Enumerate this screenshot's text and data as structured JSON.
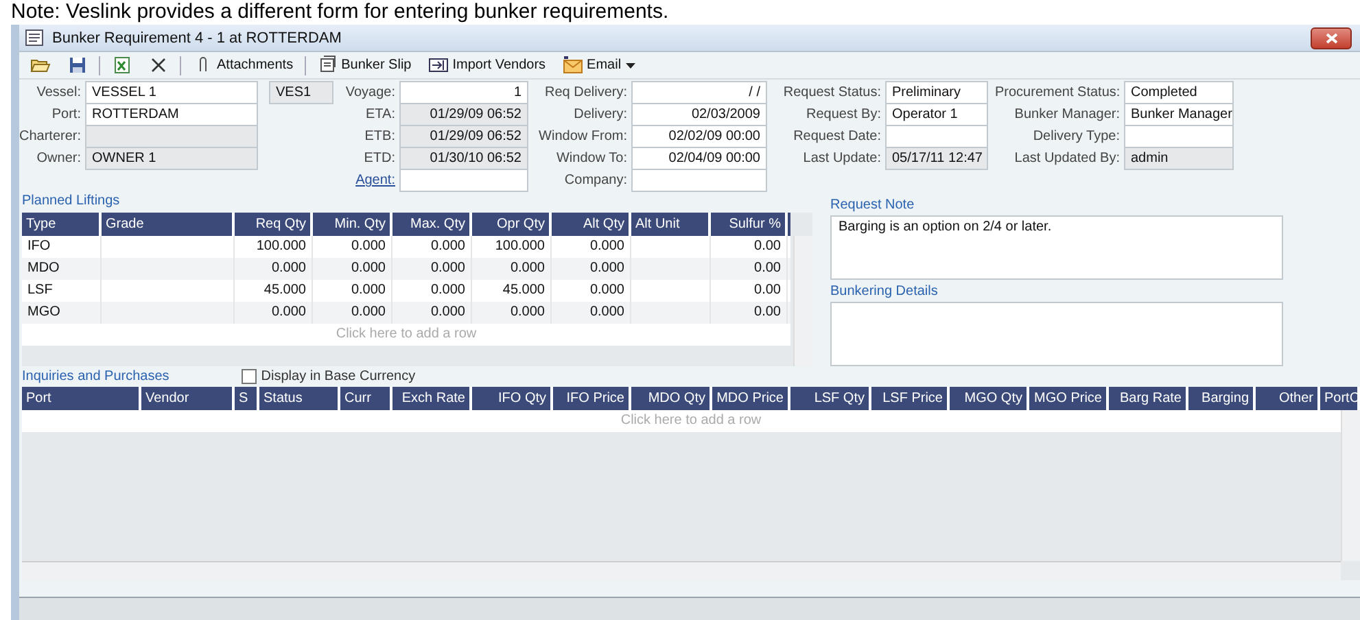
{
  "note": "Note: Veslink provides a different form for entering bunker requirements.",
  "window": {
    "title": "Bunker Requirement 4 - 1 at ROTTERDAM"
  },
  "toolbar": {
    "buttons": [
      {
        "label": "Attachments"
      },
      {
        "label": "Bunker Slip"
      },
      {
        "label": "Import Vendors"
      },
      {
        "label": "Email"
      }
    ]
  },
  "form": {
    "columns": [
      {
        "fields": [
          {
            "kind": "text",
            "label": "Vessel:",
            "value": "VESSEL 1",
            "readonly": false
          },
          {
            "kind": "text",
            "label": "Port:",
            "value": "ROTTERDAM",
            "readonly": false
          },
          {
            "kind": "text",
            "label": "Charterer:",
            "readonly": true
          },
          {
            "kind": "text",
            "label": "Owner:",
            "value": "OWNER 1",
            "readonly": true
          }
        ]
      },
      {
        "fields": [
          {
            "kind": "text",
            "value": "VES1",
            "readonly": true
          }
        ]
      },
      {
        "fields": [
          {
            "kind": "text",
            "label": "Voyage:",
            "value": "1",
            "readonly": false
          },
          {
            "kind": "text",
            "label": "ETA:",
            "value": "01/29/09 06:52",
            "readonly": true
          },
          {
            "kind": "text",
            "label": "ETB:",
            "value": "01/29/09 06:52",
            "readonly": true
          },
          {
            "kind": "text",
            "label": "ETD:",
            "value": "01/30/10 06:52",
            "readonly": true
          },
          {
            "kind": "link",
            "label": "Agent:",
            "readonly": false
          }
        ]
      },
      {
        "fields": [
          {
            "kind": "text",
            "label": "Req Delivery:",
            "value": "/ /",
            "readonly": false
          },
          {
            "kind": "text",
            "label": "Delivery:",
            "value": "02/03/2009",
            "readonly": false
          },
          {
            "kind": "text",
            "label": "Window From:",
            "value": "02/02/09 00:00",
            "readonly": false
          },
          {
            "kind": "text",
            "label": "Window To:",
            "value": "02/04/09 00:00",
            "readonly": false
          },
          {
            "kind": "text",
            "label": "Company:",
            "readonly": false
          }
        ]
      },
      {
        "fields": [
          {
            "kind": "text",
            "label": "Request Status:",
            "value": "Preliminary",
            "readonly": false
          },
          {
            "kind": "text",
            "label": "Request By:",
            "value": "Operator 1",
            "readonly": false
          },
          {
            "kind": "text",
            "label": "Request Date:",
            "readonly": false
          },
          {
            "kind": "text",
            "label": "Last Update:",
            "value": "05/17/11 12:47",
            "readonly": true
          }
        ]
      },
      {
        "fields": [
          {
            "kind": "text",
            "label": "Procurement Status:",
            "value": "Completed",
            "readonly": false
          },
          {
            "kind": "text",
            "label": "Bunker Manager:",
            "value": "Bunker Manager",
            "readonly": false
          },
          {
            "kind": "text",
            "label": "Delivery Type:",
            "readonly": false
          },
          {
            "kind": "text",
            "label": "Last Updated By:",
            "value": "admin",
            "readonly": true
          }
        ]
      }
    ]
  },
  "planned_liftings": {
    "title": "Planned Liftings",
    "columns": [
      "Type",
      "Grade",
      "Req Qty",
      "Min. Qty",
      "Max. Qty",
      "Opr Qty",
      "Alt Qty",
      "Alt Unit",
      "Sulfur %"
    ],
    "rows": [
      [
        "IFO",
        "",
        "100.000",
        "0.000",
        "0.000",
        "100.000",
        "0.000",
        "",
        "0.00"
      ],
      [
        "MDO",
        "",
        "0.000",
        "0.000",
        "0.000",
        "0.000",
        "0.000",
        "",
        "0.00"
      ],
      [
        "LSF",
        "",
        "45.000",
        "0.000",
        "0.000",
        "45.000",
        "0.000",
        "",
        "0.00"
      ],
      [
        "MGO",
        "",
        "0.000",
        "0.000",
        "0.000",
        "0.000",
        "0.000",
        "",
        "0.00"
      ]
    ],
    "add_row": "Click here to add a row"
  },
  "request_note": {
    "title": "Request Note",
    "text": "Barging is an option on 2/4 or later."
  },
  "bunkering_details": {
    "title": "Bunkering Details"
  },
  "inquiries": {
    "title": "Inquiries and Purchases",
    "display_base_currency": {
      "label": "Display in Base Currency",
      "checked": false
    },
    "columns": [
      "Port",
      "Vendor",
      "S",
      "Status",
      "Curr",
      "Exch Rate",
      "IFO Qty",
      "IFO Price",
      "MDO Qty",
      "MDO Price",
      "LSF Qty",
      "LSF Price",
      "MGO Qty",
      "MGO Price",
      "Barg Rate",
      "Barging",
      "Other",
      "PortC"
    ],
    "add_row": "Click here to add a row"
  }
}
